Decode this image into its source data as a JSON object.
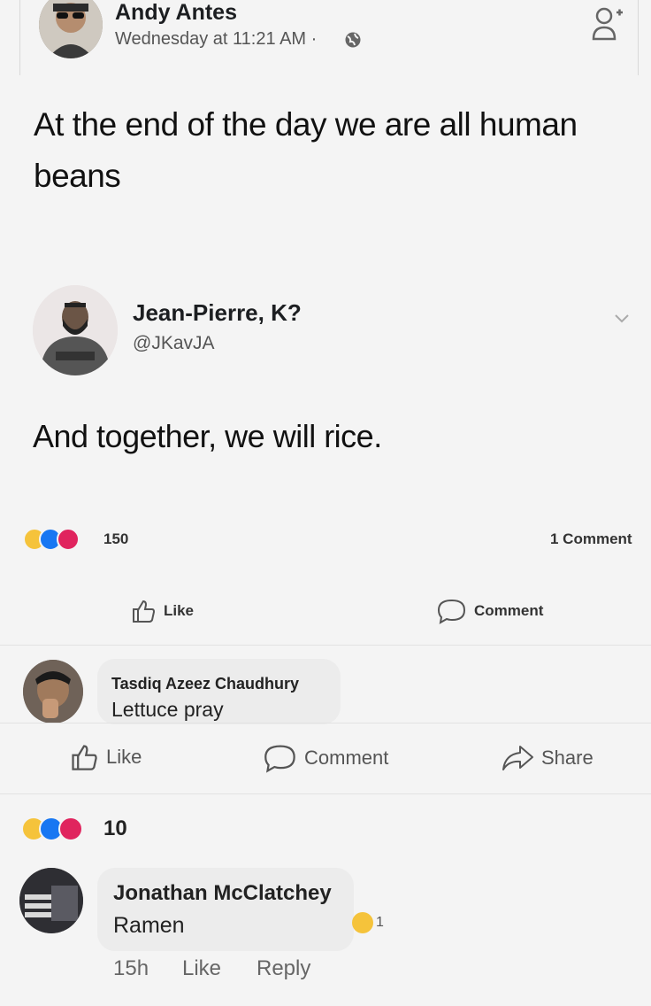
{
  "post": {
    "author": "Andy Antes",
    "time": "Wednesday at 11:21 AM ·",
    "text": "At the end of the day we are all human beans"
  },
  "tweet": {
    "name": "Jean-Pierre, K?",
    "handle": "@JKavJA",
    "text": "And together, we will rice."
  },
  "inner_stats": {
    "reactions": "150",
    "comments": "1 Comment"
  },
  "inner_actions": {
    "like": "Like",
    "comment": "Comment"
  },
  "comment1": {
    "author": "Tasdiq Azeez Chaudhury",
    "text": "Lettuce pray"
  },
  "outer_actions": {
    "like": "Like",
    "comment": "Comment",
    "share": "Share"
  },
  "outer_stats": {
    "reactions": "10"
  },
  "comment2": {
    "author": "Jonathan McClatchey",
    "text": "Ramen",
    "reaction_count": "1",
    "time": "15h",
    "like": "Like",
    "reply": "Reply"
  },
  "icons": [
    "globe-icon",
    "add-friend-icon",
    "chevron-down-icon",
    "like-icon",
    "comment-icon",
    "share-icon",
    "haha-reaction-icon",
    "like-reaction-icon",
    "love-reaction-icon"
  ],
  "colors": {
    "like_blue": "#1877f2",
    "love_red": "#e0245e",
    "haha_yellow": "#f5c33b"
  }
}
